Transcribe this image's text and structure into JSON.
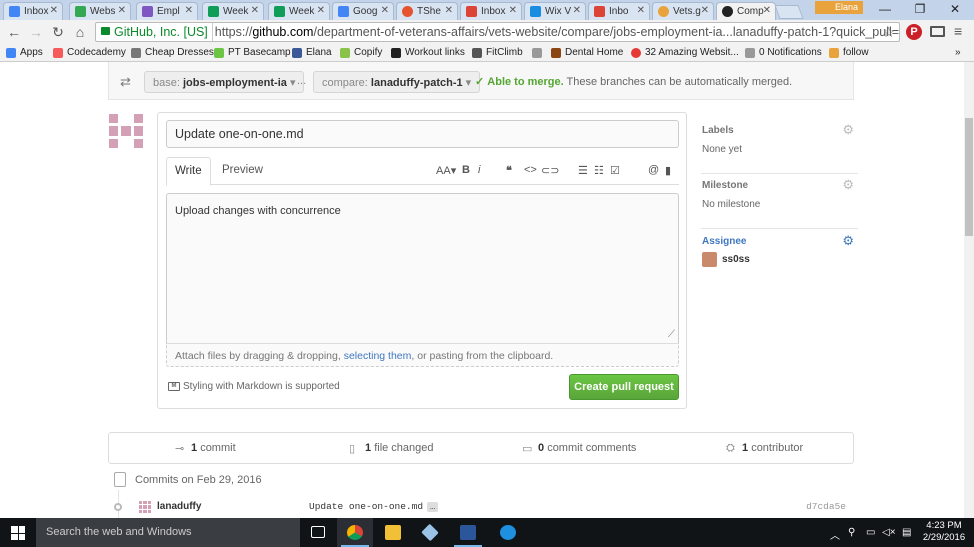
{
  "browser": {
    "tabs": [
      {
        "label": "Inbox",
        "color": "#4285f4"
      },
      {
        "label": "Webs",
        "color": "#34a853"
      },
      {
        "label": "Empl",
        "color": "#7e57c2"
      },
      {
        "label": "Week",
        "color": "#0f9d58"
      },
      {
        "label": "Week",
        "color": "#0f9d58"
      },
      {
        "label": "Goog",
        "color": "#4285f4"
      },
      {
        "label": "TShe",
        "color": "#e5542e"
      },
      {
        "label": "Inbox",
        "color": "#db4437"
      },
      {
        "label": "Wix V",
        "color": "#1a8de2"
      },
      {
        "label": "Inbo",
        "color": "#db4437"
      },
      {
        "label": "Vets.g",
        "color": "#e8a33d"
      },
      {
        "label": "Comp",
        "color": "#222222"
      }
    ],
    "user_badge": "Elana",
    "secure_label": "GitHub, Inc. [US]",
    "url_scheme": "https://",
    "url_host": "github.com",
    "url_path": "/department-of-veterans-affairs/vets-website/compare/jobs-employment-ia...lanaduffy-patch-1?quick_pull=1",
    "bookmarks": [
      {
        "label": "Apps",
        "color": "#4285f4"
      },
      {
        "label": "Codecademy",
        "color": "#f65a5b"
      },
      {
        "label": "Cheap Dresses",
        "color": "#777777"
      },
      {
        "label": "PT Basecamp",
        "color": "#6cc644"
      },
      {
        "label": "Elana",
        "color": "#3b5998"
      },
      {
        "label": "Copify",
        "color": "#8bc34a"
      },
      {
        "label": "Workout links",
        "color": "#222222"
      },
      {
        "label": "FitClimb",
        "color": "#555555"
      },
      {
        "label": "",
        "color": "#999999"
      },
      {
        "label": "Dental Home",
        "color": "#8b4513"
      },
      {
        "label": "32 Amazing Websit...",
        "color": "#e53935"
      },
      {
        "label": "0 Notifications",
        "color": "#999999"
      },
      {
        "label": "follow",
        "color": "#e8a33d"
      }
    ]
  },
  "compare": {
    "base_prefix": "base:",
    "base_branch": "jobs-employment-ia",
    "separator": "...",
    "compare_prefix": "compare:",
    "compare_branch": "lanaduffy-patch-1",
    "merge_status": "Able to merge.",
    "merge_detail": "These branches can be automatically merged."
  },
  "form": {
    "title_value": "Update one-on-one.md",
    "tab_write": "Write",
    "tab_preview": "Preview",
    "tool_heading": "AA",
    "tool_bold": "B",
    "tool_italic": "i",
    "tool_quote": "❝",
    "tool_code": "<>",
    "tool_link": "⊂⊃",
    "tool_mention": "@",
    "body_value": "Upload changes with concurrence",
    "attach_before": "Attach files by dragging & dropping, ",
    "attach_link": "selecting them",
    "attach_after": ", or pasting from the clipboard.",
    "markdown_hint": "Styling with Markdown is supported",
    "submit_label": "Create pull request"
  },
  "sidebar": {
    "labels_title": "Labels",
    "labels_value": "None yet",
    "milestone_title": "Milestone",
    "milestone_value": "No milestone",
    "assignee_title": "Assignee",
    "assignee_value": "ss0ss"
  },
  "stats": {
    "commits_count": "1",
    "commits_label": "commit",
    "files_count": "1",
    "files_label": "file changed",
    "comments_count": "0",
    "comments_label": "commit comments",
    "contributors_count": "1",
    "contributors_label": "contributor"
  },
  "commits": {
    "heading": "Commits on Feb 29, 2016",
    "rows": [
      {
        "author": "lanaduffy",
        "message": "Update one-on-one.md",
        "more": "…",
        "sha": "d7cda5e"
      }
    ]
  },
  "taskbar": {
    "search_placeholder": "Search the web and Windows",
    "time": "4:23 PM",
    "date": "2/29/2016"
  }
}
